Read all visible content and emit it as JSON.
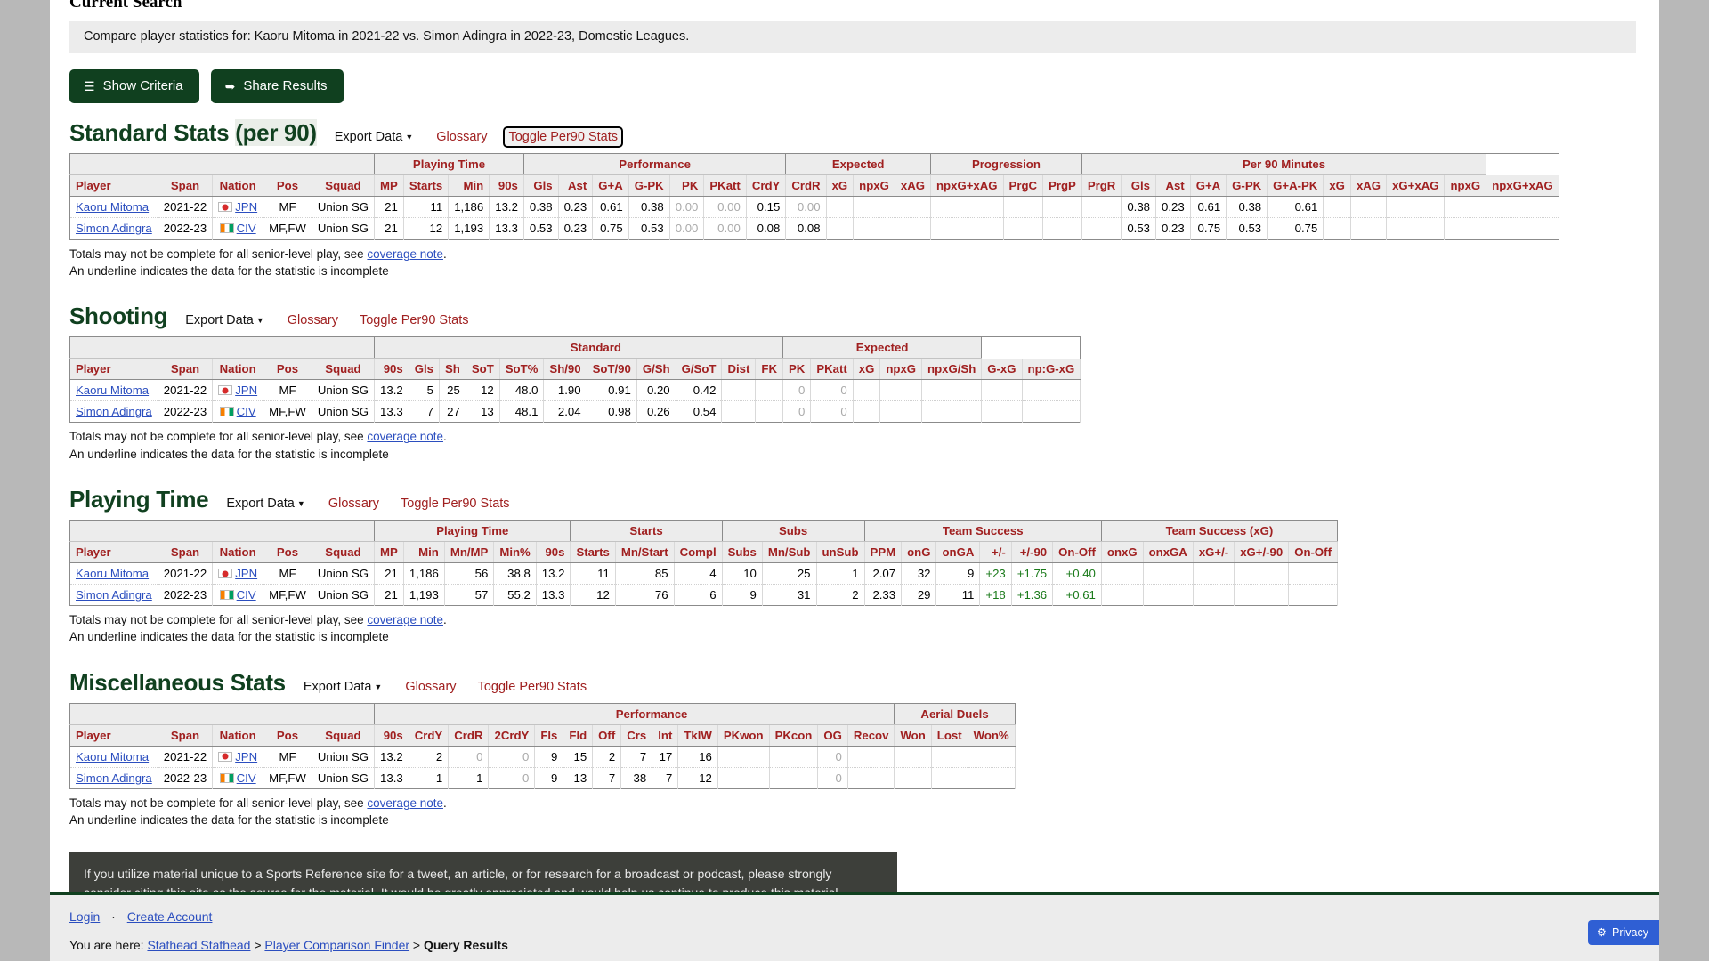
{
  "current_search": {
    "heading": "Current Search",
    "description": "Compare player statistics for: Kaoru Mitoma in 2021-22 vs. Simon Adingra in 2022-23, Domestic Leagues."
  },
  "buttons": {
    "show_criteria": "Show Criteria",
    "share_results": "Share Results",
    "hamburger_icon": "hamburger-icon",
    "share_icon": "share-arrow-icon"
  },
  "links": {
    "export_data": "Export Data",
    "glossary": "Glossary",
    "toggle_per90": "Toggle Per90 Stats",
    "caret": "▼"
  },
  "notes": {
    "totals_prefix": "Totals may not be complete for all senior-level play, see ",
    "coverage_note": "coverage note",
    "totals_suffix": ".",
    "underline_note": "An underline indicates the data for the statistic is incomplete"
  },
  "sections": [
    {
      "id": "standard-stats",
      "title_main": "Standard Stats ",
      "title_per90": "(per 90)",
      "over_groups": [
        {
          "label": "",
          "span": 5
        },
        {
          "label": "Playing Time",
          "span": 4
        },
        {
          "label": "Performance",
          "span": 7
        },
        {
          "label": "Expected",
          "span": 4
        },
        {
          "label": "Progression",
          "span": 3
        },
        {
          "label": "Per 90 Minutes",
          "span": 10
        }
      ],
      "columns": [
        "Player",
        "Span",
        "Nation",
        "Pos",
        "Squad",
        "MP",
        "Starts",
        "Min",
        "90s",
        "Gls",
        "Ast",
        "G+A",
        "G-PK",
        "PK",
        "PKatt",
        "CrdY",
        "CrdR",
        "xG",
        "npxG",
        "xAG",
        "npxG+xAG",
        "PrgC",
        "PrgP",
        "PrgR",
        "Gls",
        "Ast",
        "G+A",
        "G-PK",
        "G+A-PK",
        "xG",
        "xAG",
        "xG+xAG",
        "npxG",
        "npxG+xAG"
      ],
      "rows": [
        {
          "player": "Kaoru Mitoma",
          "span": "2021-22",
          "nation": "JPN",
          "flag": "jpn",
          "pos": "MF",
          "squad": "Union SG",
          "cells": [
            "21",
            "11",
            "1,186",
            "13.2",
            "0.38",
            "0.23",
            "0.61",
            "0.38",
            "0.00",
            "0.00",
            "0.15",
            "0.00",
            "",
            "",
            "",
            "",
            "",
            "",
            "",
            "0.38",
            "0.23",
            "0.61",
            "0.38",
            "0.61",
            "",
            "",
            "",
            "",
            ""
          ],
          "dim": [
            8,
            9,
            11
          ]
        },
        {
          "player": "Simon Adingra",
          "span": "2022-23",
          "nation": "CIV",
          "flag": "civ",
          "pos": "MF,FW",
          "squad": "Union SG",
          "cells": [
            "21",
            "12",
            "1,193",
            "13.3",
            "0.53",
            "0.23",
            "0.75",
            "0.53",
            "0.00",
            "0.00",
            "0.08",
            "0.08",
            "",
            "",
            "",
            "",
            "",
            "",
            "",
            "0.53",
            "0.23",
            "0.75",
            "0.53",
            "0.75",
            "",
            "",
            "",
            "",
            ""
          ],
          "dim": [
            8,
            9
          ]
        }
      ]
    },
    {
      "id": "shooting",
      "title_main": "Shooting",
      "title_per90": "",
      "over_groups": [
        {
          "label": "",
          "span": 5
        },
        {
          "label": "",
          "span": 1
        },
        {
          "label": "Standard",
          "span": 10
        },
        {
          "label": "Expected",
          "span": 5
        }
      ],
      "columns": [
        "Player",
        "Span",
        "Nation",
        "Pos",
        "Squad",
        "90s",
        "Gls",
        "Sh",
        "SoT",
        "SoT%",
        "Sh/90",
        "SoT/90",
        "G/Sh",
        "G/SoT",
        "Dist",
        "FK",
        "PK",
        "PKatt",
        "xG",
        "npxG",
        "npxG/Sh",
        "G-xG",
        "np:G-xG"
      ],
      "rows": [
        {
          "player": "Kaoru Mitoma",
          "span": "2021-22",
          "nation": "JPN",
          "flag": "jpn",
          "pos": "MF",
          "squad": "Union SG",
          "cells": [
            "13.2",
            "5",
            "25",
            "12",
            "48.0",
            "1.90",
            "0.91",
            "0.20",
            "0.42",
            "",
            "",
            "0",
            "0",
            "",
            "",
            "",
            "",
            ""
          ],
          "dim": [
            11,
            12
          ]
        },
        {
          "player": "Simon Adingra",
          "span": "2022-23",
          "nation": "CIV",
          "flag": "civ",
          "pos": "MF,FW",
          "squad": "Union SG",
          "cells": [
            "13.3",
            "7",
            "27",
            "13",
            "48.1",
            "2.04",
            "0.98",
            "0.26",
            "0.54",
            "",
            "",
            "0",
            "0",
            "",
            "",
            "",
            "",
            ""
          ],
          "dim": [
            11,
            12
          ]
        }
      ]
    },
    {
      "id": "playing-time",
      "title_main": "Playing Time",
      "title_per90": "",
      "over_groups": [
        {
          "label": "",
          "span": 5
        },
        {
          "label": "Playing Time",
          "span": 5
        },
        {
          "label": "Starts",
          "span": 3
        },
        {
          "label": "Subs",
          "span": 3
        },
        {
          "label": "Team Success",
          "span": 6
        },
        {
          "label": "Team Success (xG)",
          "span": 5
        }
      ],
      "columns": [
        "Player",
        "Span",
        "Nation",
        "Pos",
        "Squad",
        "MP",
        "Min",
        "Mn/MP",
        "Min%",
        "90s",
        "Starts",
        "Mn/Start",
        "Compl",
        "Subs",
        "Mn/Sub",
        "unSub",
        "PPM",
        "onG",
        "onGA",
        "+/-",
        "+/-90",
        "On-Off",
        "onxG",
        "onxGA",
        "xG+/-",
        "xG+/-90",
        "On-Off"
      ],
      "rows": [
        {
          "player": "Kaoru Mitoma",
          "span": "2021-22",
          "nation": "JPN",
          "flag": "jpn",
          "pos": "MF",
          "squad": "Union SG",
          "cells": [
            "21",
            "1,186",
            "56",
            "38.8",
            "13.2",
            "11",
            "85",
            "4",
            "10",
            "25",
            "1",
            "2.07",
            "32",
            "9",
            "+23",
            "+1.75",
            "+0.40",
            "",
            "",
            "",
            "",
            ""
          ],
          "green": [
            14,
            15,
            16
          ]
        },
        {
          "player": "Simon Adingra",
          "span": "2022-23",
          "nation": "CIV",
          "flag": "civ",
          "pos": "MF,FW",
          "squad": "Union SG",
          "cells": [
            "21",
            "1,193",
            "57",
            "55.2",
            "13.3",
            "12",
            "76",
            "6",
            "9",
            "31",
            "2",
            "2.33",
            "29",
            "11",
            "+18",
            "+1.36",
            "+0.61",
            "",
            "",
            "",
            "",
            ""
          ],
          "green": [
            14,
            15,
            16
          ]
        }
      ]
    },
    {
      "id": "miscellaneous-stats",
      "title_main": "Miscellaneous Stats",
      "title_per90": "",
      "over_groups": [
        {
          "label": "",
          "span": 5
        },
        {
          "label": "",
          "span": 1
        },
        {
          "label": "Performance",
          "span": 13
        },
        {
          "label": "Aerial Duels",
          "span": 3
        }
      ],
      "columns": [
        "Player",
        "Span",
        "Nation",
        "Pos",
        "Squad",
        "90s",
        "CrdY",
        "CrdR",
        "2CrdY",
        "Fls",
        "Fld",
        "Off",
        "Crs",
        "Int",
        "TklW",
        "PKwon",
        "PKcon",
        "OG",
        "Recov",
        "Won",
        "Lost",
        "Won%"
      ],
      "rows": [
        {
          "player": "Kaoru Mitoma",
          "span": "2021-22",
          "nation": "JPN",
          "flag": "jpn",
          "pos": "MF",
          "squad": "Union SG",
          "cells": [
            "13.2",
            "2",
            "0",
            "0",
            "9",
            "15",
            "2",
            "7",
            "17",
            "16",
            "",
            "",
            "0",
            "",
            "",
            "",
            ""
          ],
          "dim": [
            2,
            3,
            12
          ]
        },
        {
          "player": "Simon Adingra",
          "span": "2022-23",
          "nation": "CIV",
          "flag": "civ",
          "pos": "MF,FW",
          "squad": "Union SG",
          "cells": [
            "13.3",
            "1",
            "1",
            "0",
            "9",
            "13",
            "7",
            "38",
            "7",
            "12",
            "",
            "",
            "0",
            "",
            "",
            "",
            ""
          ],
          "dim": [
            3,
            12
          ]
        }
      ]
    }
  ],
  "citation": "If you utilize material unique to a Sports Reference site for a tweet, an article, or for research for a broadcast or podcast, please strongly consider citing this site as the source for the material. It would be greatly appreciated and would help us continue to produce this material.",
  "footer": {
    "login": "Login",
    "separator": "·",
    "create_account": "Create Account",
    "breadcrumb_prefix": "You are here: ",
    "crumb1": "Stathead Stathead",
    "arrow": " > ",
    "crumb2": "Player Comparison Finder",
    "crumb3": "Query Results"
  },
  "privacy": {
    "label": "Privacy",
    "icon": "gear-icon",
    "color": "#2f5fd4"
  }
}
